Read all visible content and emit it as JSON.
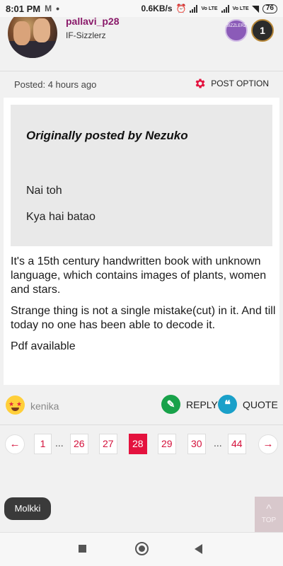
{
  "status_bar": {
    "time": "8:01 PM",
    "network_speed": "0.6KB/s",
    "lte1": "Vo LTE",
    "lte2": "Vo LTE",
    "battery": "76"
  },
  "user": {
    "username": "pallavi_p28",
    "title": "IF-Sizzlerz",
    "badge1_text": "SIZZLERZ",
    "badge2_text": "1"
  },
  "post_meta": {
    "posted": "Posted: 4 hours ago",
    "post_option": "POST OPTION"
  },
  "quote": {
    "author": "Originally posted by Nezuko",
    "line1": "Nai toh",
    "line2": "Kya hai batao"
  },
  "post_body": {
    "p1": "It's a 15th century handwritten book with unknown language, which contains images of plants, women and stars.",
    "p2": "Strange thing is not a single mistake(cut) in it. And till today no one has been able to decode it.",
    "p3": "Pdf available"
  },
  "actions": {
    "liker": "kenika",
    "reply": "REPLY",
    "quote": "QUOTE"
  },
  "pagination": {
    "prev_icon": "←",
    "next_icon": "→",
    "ellipsis": "...",
    "pages": [
      "1",
      "26",
      "27",
      "28",
      "29",
      "30",
      "44"
    ],
    "current_page": "28"
  },
  "chip": "Molkki",
  "top_button": {
    "label": "TOP",
    "icon": "^"
  },
  "colors": {
    "accent": "#e4123e",
    "reply": "#18a24a",
    "quote": "#1aa0c9",
    "username": "#8a1a6a"
  }
}
